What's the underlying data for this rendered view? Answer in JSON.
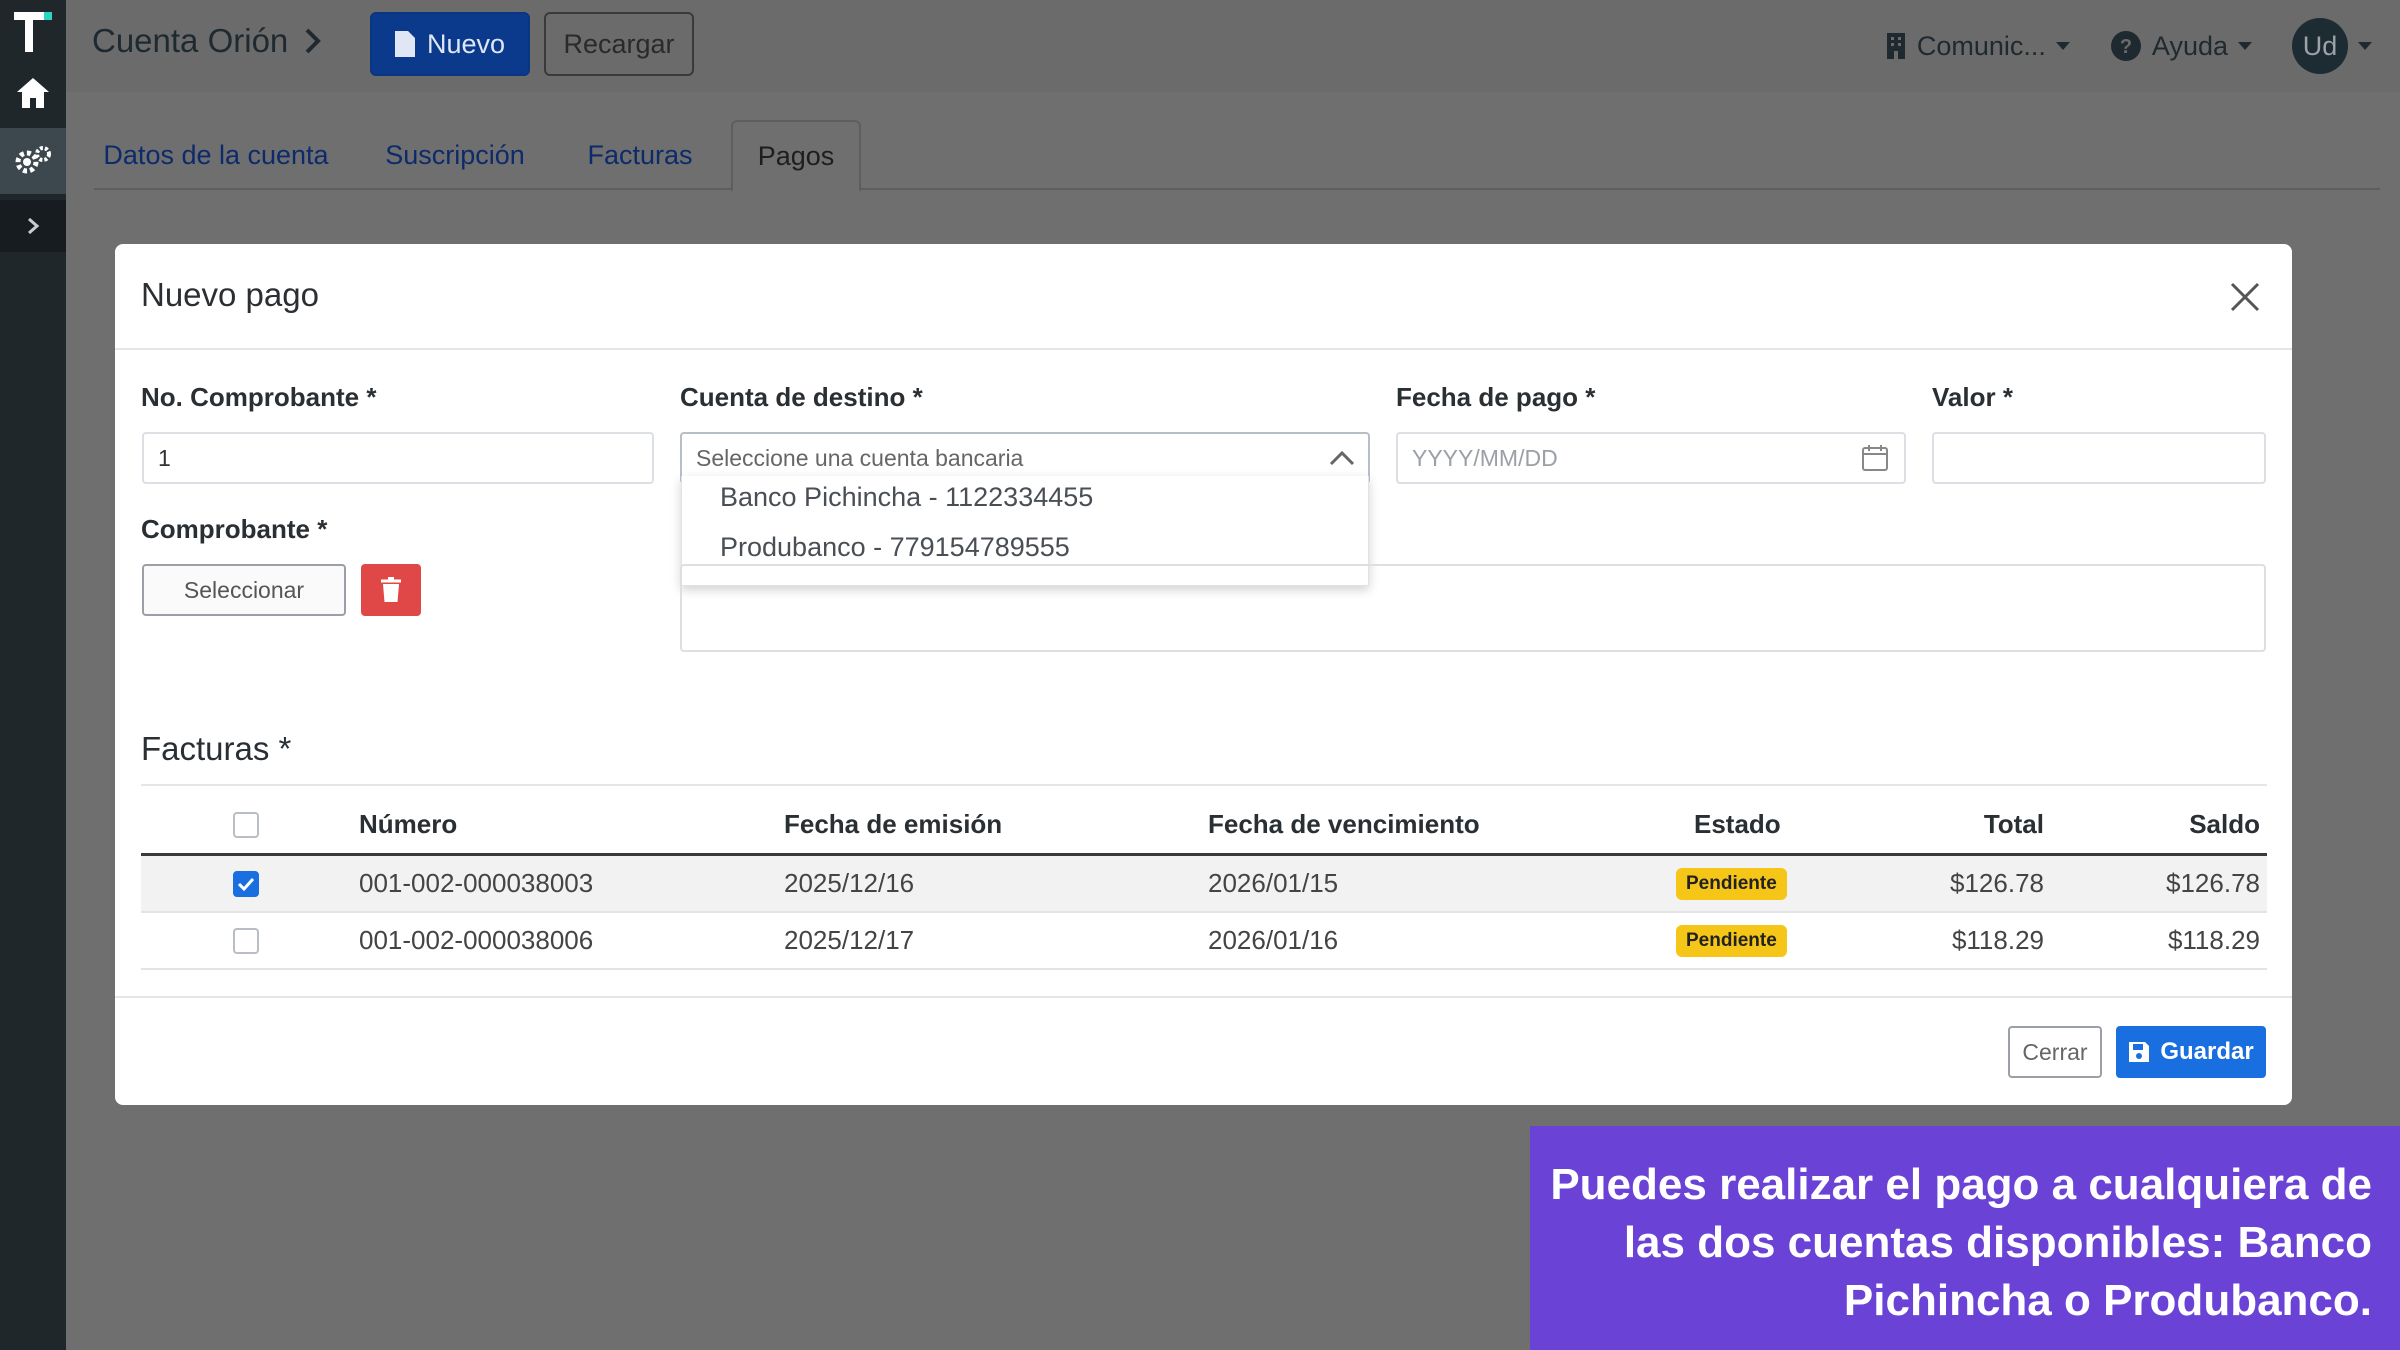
{
  "header": {
    "breadcrumb_title": "Cuenta Orión",
    "new_label": "Nuevo",
    "reload_label": "Recargar",
    "company_label": "Comunic...",
    "help_label": "Ayuda",
    "avatar_initials": "Ud"
  },
  "tabs": [
    {
      "label": "Datos de la cuenta"
    },
    {
      "label": "Suscripción"
    },
    {
      "label": "Facturas"
    },
    {
      "label": "Pagos"
    }
  ],
  "active_tab": "Pagos",
  "modal": {
    "title": "Nuevo pago",
    "receipt_no_label": "No. Comprobante *",
    "receipt_no_value": "1",
    "dest_account_label": "Cuenta de destino *",
    "dest_account_placeholder": "Seleccione una cuenta bancaria",
    "dest_account_options": [
      "Banco Pichincha - 1122334455",
      "Produbanco - 779154789555"
    ],
    "pay_date_label": "Fecha de pago *",
    "pay_date_placeholder": "YYYY/MM/DD",
    "value_label": "Valor *",
    "value_value": "",
    "receipt_label": "Comprobante *",
    "select_button": "Seleccionar",
    "invoices_title": "Facturas *",
    "close_button": "Cerrar",
    "save_button": "Guardar"
  },
  "invoices_table": {
    "headers": [
      "Número",
      "Fecha de emisión",
      "Fecha de vencimiento",
      "Estado",
      "Total",
      "Saldo"
    ],
    "rows": [
      {
        "checked": true,
        "number": "001-002-000038003",
        "issued": "2025/12/16",
        "due": "2026/01/15",
        "status": "Pendiente",
        "total": "$126.78",
        "balance": "$126.78"
      },
      {
        "checked": false,
        "number": "001-002-000038006",
        "issued": "2025/12/17",
        "due": "2026/01/16",
        "status": "Pendiente",
        "total": "$118.29",
        "balance": "$118.29"
      }
    ]
  },
  "caption": {
    "text": "Puedes realizar el pago a cualquiera de las dos cuentas disponibles: Banco Pichincha o Produbanco."
  },
  "colors": {
    "primary": "#1a6fe0",
    "danger": "#e04848",
    "badge_pending": "#f5c518",
    "caption_bg": "#6a43d6",
    "sidebar_bg": "#20272b"
  }
}
